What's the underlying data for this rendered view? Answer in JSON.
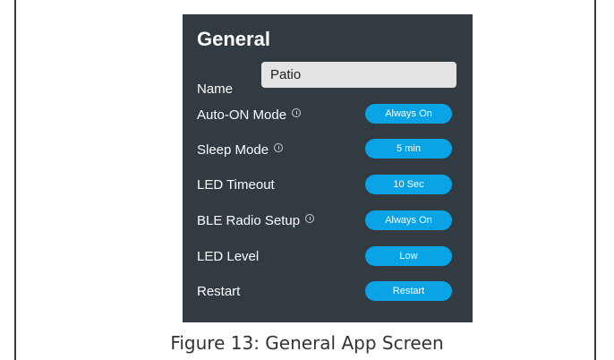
{
  "panel": {
    "title": "General",
    "name": {
      "label": "Name",
      "value": "Patio"
    },
    "rows": [
      {
        "label": "Auto-ON Mode",
        "info": true,
        "button": "Always On"
      },
      {
        "label": "Sleep Mode",
        "info": true,
        "button": "5 min"
      },
      {
        "label": "LED Timeout",
        "info": false,
        "button": "10 Sec"
      },
      {
        "label": "BLE Radio Setup",
        "info": true,
        "button": "Always On"
      },
      {
        "label": "LED Level",
        "info": false,
        "button": "Low"
      },
      {
        "label": "Restart",
        "info": false,
        "button": "Restart"
      }
    ]
  },
  "caption": "Figure 13: General App Screen",
  "colors": {
    "panel_bg": "#323a42",
    "accent": "#0aa4e6",
    "field_bg": "#e3e3e3"
  },
  "icons": {
    "info": "info-icon"
  }
}
